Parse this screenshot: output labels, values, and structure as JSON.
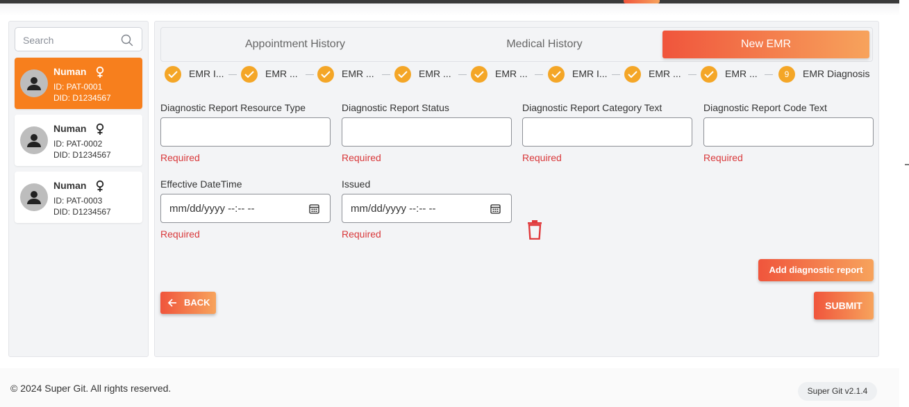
{
  "sidebar": {
    "search": {
      "placeholder": "Search"
    },
    "patients": [
      {
        "name": "Numan",
        "id": "ID: PAT-0001",
        "did": "DID: D1234567",
        "active": true
      },
      {
        "name": "Numan",
        "id": "ID: PAT-0002",
        "did": "DID: D1234567",
        "active": false
      },
      {
        "name": "Numan",
        "id": "ID: PAT-0003",
        "did": "DID: D1234567",
        "active": false
      }
    ]
  },
  "tabs": {
    "appointment_history": "Appointment History",
    "medical_history": "Medical History",
    "new_emr": "New EMR"
  },
  "steps": [
    {
      "label": "EMR I...",
      "done": true
    },
    {
      "label": "EMR ...",
      "done": true
    },
    {
      "label": "EMR ...",
      "done": true
    },
    {
      "label": "EMR ...",
      "done": true
    },
    {
      "label": "EMR ...",
      "done": true
    },
    {
      "label": "EMR I...",
      "done": true
    },
    {
      "label": "EMR ...",
      "done": true
    },
    {
      "label": "EMR ...",
      "done": true
    },
    {
      "label": "EMR Diagnosis",
      "number": "9",
      "done": false
    }
  ],
  "form": {
    "resource_type": {
      "label": "Diagnostic Report Resource Type",
      "value": "",
      "error": "Required"
    },
    "status": {
      "label": "Diagnostic Report Status",
      "value": "",
      "error": "Required"
    },
    "category_text": {
      "label": "Diagnostic Report Category Text",
      "value": "",
      "error": "Required"
    },
    "code_text": {
      "label": "Diagnostic Report Code Text",
      "value": "",
      "error": "Required"
    },
    "effective_datetime": {
      "label": "Effective DateTime",
      "value": "mm/dd/yyyy --:-- --",
      "error": "Required"
    },
    "issued": {
      "label": "Issued",
      "value": "mm/dd/yyyy --:-- --",
      "error": "Required"
    }
  },
  "buttons": {
    "add_report": "Add diagnostic report",
    "back": "BACK",
    "submit": "SUBMIT"
  },
  "footer": {
    "copyright": "© 2024 Super Git. All rights reserved.",
    "version": "Super Git v2.1.4"
  },
  "colors": {
    "accent_start": "#f0553c",
    "accent_end": "#f7a35c",
    "active_patient": "#f77f1d",
    "step_done": "#f4a627",
    "error": "#d9383a"
  }
}
